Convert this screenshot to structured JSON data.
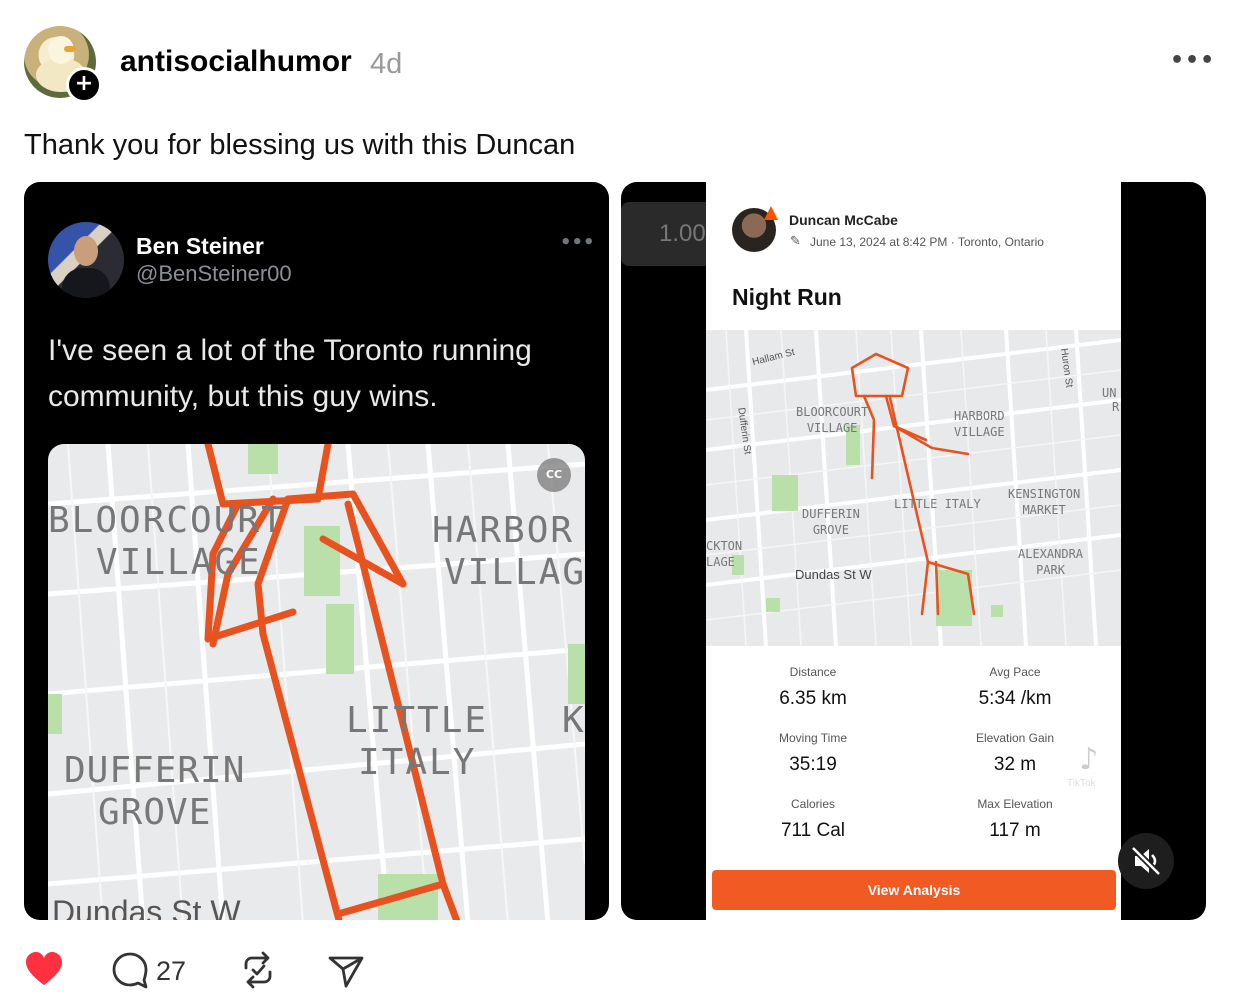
{
  "post": {
    "username": "antisocialhumor",
    "time": "4d",
    "text": "Thank you for blessing us with this Duncan",
    "reply_count": "27"
  },
  "tweet": {
    "name": "Ben Steiner",
    "handle": "@BenSteiner00",
    "text": "I've seen a lot of the Toronto running community, but this guy wins.",
    "map_labels": {
      "bloorcourt": [
        "BLOORCOURT",
        "VILLAGE"
      ],
      "harbord": [
        "HARBOR",
        "VILLAG"
      ],
      "little_italy": [
        "LITTLE",
        "ITALY"
      ],
      "dufferin": [
        "DUFFERIN",
        "GROVE"
      ],
      "dundas": "Dundas St W",
      "k": "K"
    },
    "cc_label": "CC"
  },
  "video": {
    "speed": "1.00",
    "athlete": "Duncan McCabe",
    "date": "June 13, 2024 at 8:42 PM · Toronto, Ontario",
    "activity_title": "Night Run",
    "map_labels": {
      "hallam": "Hallam St",
      "dufferin_st": "Dufferin St",
      "huron": "Huron St",
      "bloorcourt": [
        "BLOORCOURT",
        "VILLAGE"
      ],
      "harbord": [
        "HARBORD",
        "VILLAGE"
      ],
      "little_italy": "LITTLE ITALY",
      "kensington": [
        "KENSINGTON",
        "MARKET"
      ],
      "dufferin_grove": [
        "DUFFERIN",
        "GROVE"
      ],
      "dundas": "Dundas St W",
      "alexandra": [
        "ALEXANDRA",
        "PARK"
      ],
      "ckton": [
        "CKTON",
        "LAGE"
      ],
      "un": [
        "UN",
        "R"
      ]
    },
    "stats": [
      {
        "label": "Distance",
        "value": "6.35 km"
      },
      {
        "label": "Avg Pace",
        "value": "5:34 /km"
      },
      {
        "label": "Moving Time",
        "value": "35:19"
      },
      {
        "label": "Elevation Gain",
        "value": "32 m"
      },
      {
        "label": "Calories",
        "value": "711 Cal"
      },
      {
        "label": "Max Elevation",
        "value": "117 m"
      }
    ],
    "button": "View Analysis",
    "watermark": "TikTok"
  },
  "colors": {
    "route": "#e8521f",
    "strava_orange": "#f15a22",
    "like_red": "#ff3040"
  }
}
